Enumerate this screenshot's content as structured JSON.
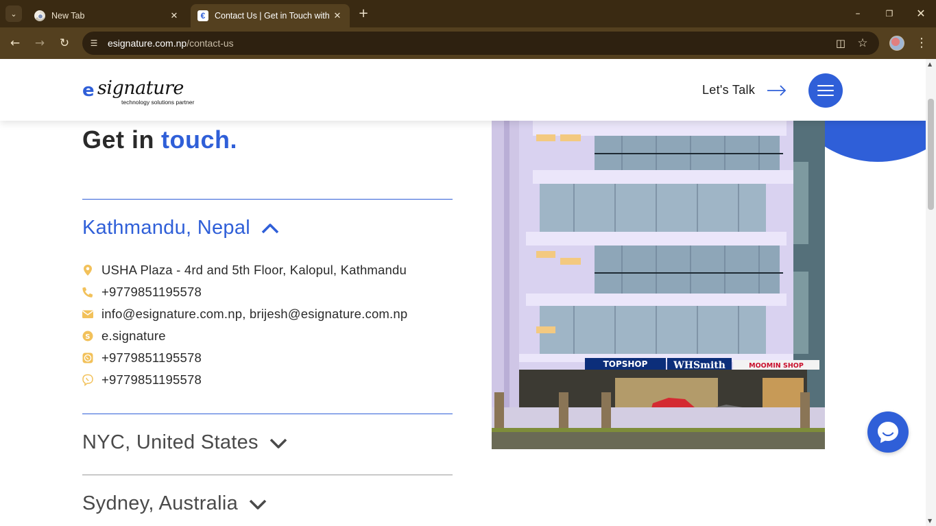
{
  "browser": {
    "tabs": [
      {
        "title": "New Tab",
        "favicon": "chrome-icon",
        "active": false
      },
      {
        "title": "Contact Us | Get in Touch with e.signature",
        "favicon": "esignature-favicon",
        "active": true
      }
    ],
    "url_host": "esignature.com.np",
    "url_path": "/contact-us",
    "icons": {
      "tab_search": "chevron-down-icon",
      "new_tab": "plus-icon",
      "back": "arrow-left-icon",
      "forward": "arrow-right-icon",
      "reload": "reload-icon",
      "site_info": "tune-icon",
      "install": "install-app-icon",
      "bookmark": "star-icon",
      "menu": "more-vert-icon"
    }
  },
  "header": {
    "logo_mark": "e",
    "logo_word": "signature",
    "logo_tagline": "technology solutions partner",
    "cta_label": "Let's Talk"
  },
  "page": {
    "heading_plain": "Get in",
    "heading_accent": "touch."
  },
  "offices": [
    {
      "name": "Kathmandu, Nepal",
      "expanded": true,
      "contacts": [
        {
          "icon": "map-pin-icon",
          "text": "USHA Plaza - 4rd and 5th Floor, Kalopul, Kathmandu"
        },
        {
          "icon": "phone-icon",
          "text": "+9779851195578"
        },
        {
          "icon": "envelope-icon",
          "text": "info@esignature.com.np, brijesh@esignature.com.np"
        },
        {
          "icon": "skype-icon",
          "text": "e.signature"
        },
        {
          "icon": "whatsapp-icon",
          "text": "+9779851195578"
        },
        {
          "icon": "viber-icon",
          "text": "+9779851195578"
        }
      ]
    },
    {
      "name": "NYC, United States",
      "expanded": false
    },
    {
      "name": "Sydney, Australia",
      "expanded": false
    }
  ],
  "building_signs": [
    "TOPSHOP",
    "WHSmith",
    "MOOMIN SHOP"
  ],
  "colors": {
    "brand_blue": "#2f5fd8",
    "icon_gold": "#f2c15a",
    "chrome_dark": "#3a2a12",
    "chrome_toolbar": "#54401f"
  }
}
